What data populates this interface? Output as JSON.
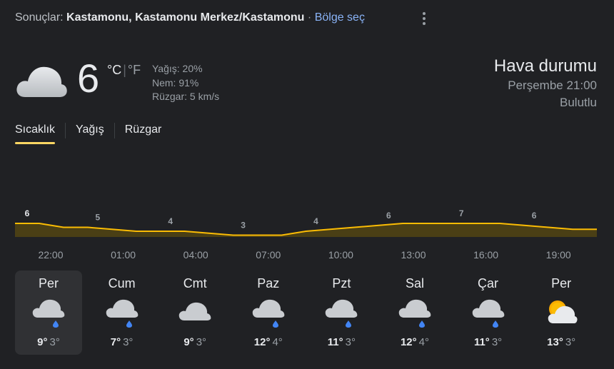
{
  "header": {
    "results_prefix": "Sonuçlar:",
    "location": "Kastamonu, Kastamonu Merkez/Kastamonu",
    "separator": "·",
    "region_link": "Bölge seç"
  },
  "current": {
    "temperature": "6",
    "unit_c": "°C",
    "unit_f": "°F",
    "precip": "Yağış: 20%",
    "humidity": "Nem: 91%",
    "wind": "Rüzgar: 5 km/s",
    "icon": "cloudy-icon"
  },
  "summary": {
    "title": "Hava durumu",
    "datetime": "Perşembe 21:00",
    "condition": "Bulutlu"
  },
  "tabs": [
    {
      "label": "Sıcaklık",
      "active": true
    },
    {
      "label": "Yağış",
      "active": false
    },
    {
      "label": "Rüzgar",
      "active": false
    }
  ],
  "chart_data": {
    "type": "area",
    "x": [
      "22:00",
      "01:00",
      "04:00",
      "07:00",
      "10:00",
      "13:00",
      "16:00",
      "19:00"
    ],
    "labels": [
      "6",
      "5",
      "4",
      "3",
      "4",
      "6",
      "7",
      "6"
    ],
    "hourly_values": [
      6,
      6,
      5,
      5,
      4.5,
      4,
      4,
      4,
      3.5,
      3,
      3,
      3,
      4,
      4.5,
      5,
      5.5,
      6,
      6,
      6,
      6,
      6,
      5.5,
      5,
      4.5,
      4.5
    ],
    "line_color": "#fbbc04"
  },
  "daily": [
    {
      "name": "Per",
      "hi": "9°",
      "lo": "3°",
      "icon": "rain-icon",
      "selected": true
    },
    {
      "name": "Cum",
      "hi": "7°",
      "lo": "3°",
      "icon": "rain-icon",
      "selected": false
    },
    {
      "name": "Cmt",
      "hi": "9°",
      "lo": "3°",
      "icon": "cloud-icon",
      "selected": false
    },
    {
      "name": "Paz",
      "hi": "12°",
      "lo": "4°",
      "icon": "rain-icon",
      "selected": false
    },
    {
      "name": "Pzt",
      "hi": "11°",
      "lo": "3°",
      "icon": "rain-icon",
      "selected": false
    },
    {
      "name": "Sal",
      "hi": "12°",
      "lo": "4°",
      "icon": "rain-icon",
      "selected": false
    },
    {
      "name": "Çar",
      "hi": "11°",
      "lo": "3°",
      "icon": "rain-icon",
      "selected": false
    },
    {
      "name": "Per",
      "hi": "13°",
      "lo": "3°",
      "icon": "partly-sunny-icon",
      "selected": false
    }
  ]
}
